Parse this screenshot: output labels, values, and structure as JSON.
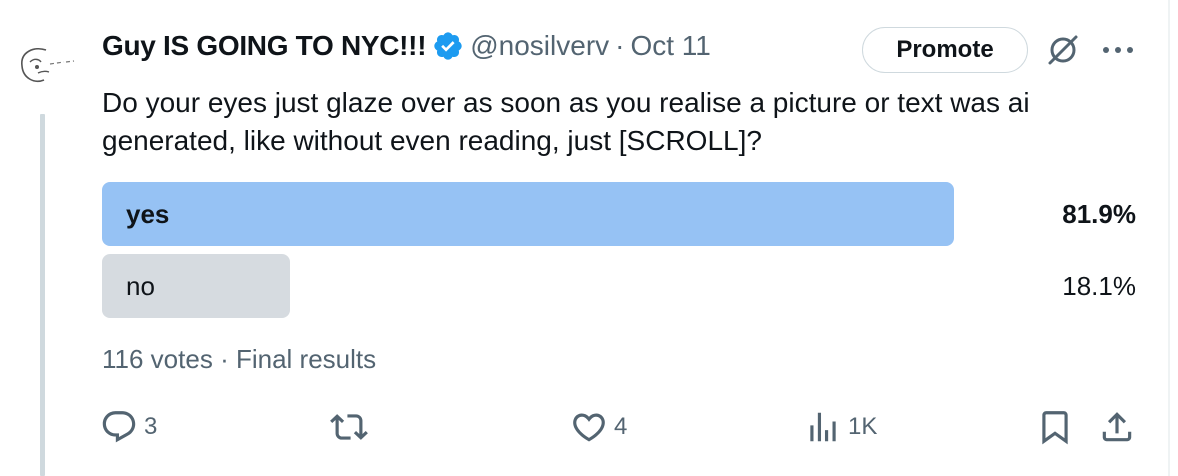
{
  "author": {
    "display_name": "Guy IS GOING TO NYC!!!",
    "handle": "@nosilverv",
    "separator": "·",
    "date": "Oct 11",
    "verified": true
  },
  "header_actions": {
    "promote_label": "Promote",
    "grok_icon": "grok-icon",
    "more_icon": "more-icon"
  },
  "tweet": {
    "text": "Do your eyes just glaze over as soon as you realise a picture or text was ai generated, like without even reading, just [SCROLL]?"
  },
  "poll": {
    "options": [
      {
        "label": "yes",
        "percent_text": "81.9%",
        "fraction": 0.819,
        "winner": true
      },
      {
        "label": "no",
        "percent_text": "18.1%",
        "fraction": 0.181,
        "winner": false
      }
    ],
    "votes_text": "116 votes",
    "separator": "·",
    "status_text": "Final results"
  },
  "actions": {
    "reply_count": "3",
    "repost_count": "",
    "like_count": "4",
    "views_count": "1K"
  },
  "colors": {
    "winner_bar": "#96c2f4",
    "loser_bar": "#d6dbe0",
    "verified_badge": "#1d9bf0",
    "secondary_text": "#536471"
  }
}
